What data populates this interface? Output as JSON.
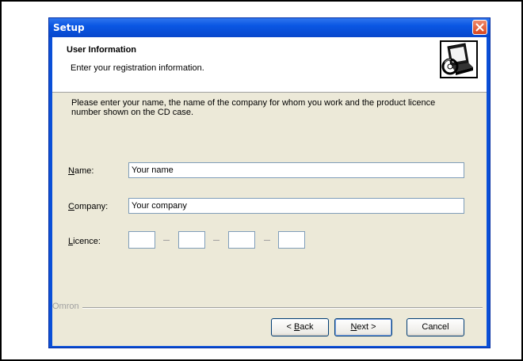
{
  "window": {
    "title": "Setup"
  },
  "header": {
    "title": "User Information",
    "subtitle": "Enter your registration information.",
    "icon": "computer-cd-icon"
  },
  "intro": {
    "text": "Please enter your name, the name of the company for whom you work and the product licence number shown on the CD case."
  },
  "fields": {
    "name": {
      "label_accel": "N",
      "label_rest": "ame:",
      "value": "Your name"
    },
    "company": {
      "label_accel": "C",
      "label_rest": "ompany:",
      "value": "Your company"
    },
    "licence": {
      "label_accel": "L",
      "label_rest": "icence:",
      "segments": [
        "",
        "",
        "",
        ""
      ],
      "separator": "–"
    }
  },
  "group": {
    "label": "Omron"
  },
  "buttons": {
    "back": {
      "prefix": "< ",
      "accel": "B",
      "rest": "ack"
    },
    "next": {
      "accel": "N",
      "rest": "ext >"
    },
    "cancel": {
      "label": "Cancel"
    }
  },
  "colors": {
    "titlebar": "#0a56e3",
    "client": "#ece9d8",
    "close": "#d9461f"
  }
}
